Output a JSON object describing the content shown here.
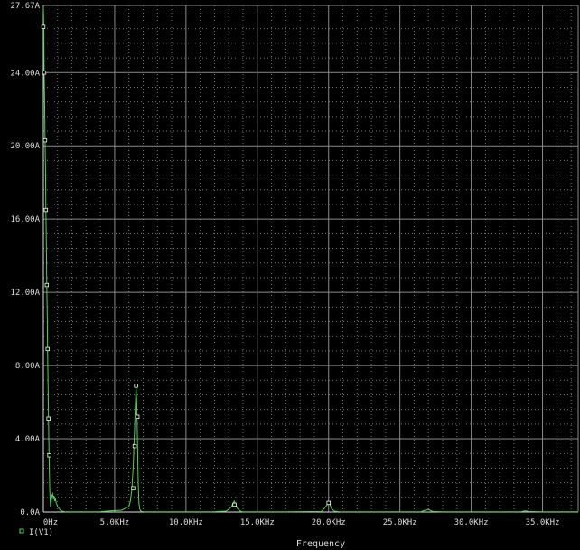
{
  "chart_data": {
    "type": "line",
    "title": "",
    "xlabel": "Frequency",
    "ylabel": "",
    "xlim": [
      0,
      37500
    ],
    "ylim": [
      0,
      27.67
    ],
    "x_tick_labels": [
      "0Hz",
      "5.0KHz",
      "10.0KHz",
      "15.0KHz",
      "20.0KHz",
      "25.0KHz",
      "30.0KHz",
      "35.0KHz"
    ],
    "x_tick_values": [
      0,
      5000,
      10000,
      15000,
      20000,
      25000,
      30000,
      35000
    ],
    "y_tick_labels": [
      "0.0A",
      "4.00A",
      "8.00A",
      "12.00A",
      "16.00A",
      "20.00A",
      "24.00A",
      "27.67A"
    ],
    "y_tick_values": [
      0,
      4,
      8,
      12,
      16,
      20,
      24,
      27.67
    ],
    "grid": true,
    "legend_position": "bottom-left",
    "series": [
      {
        "name": "I(V1)",
        "color": "#4cd64c",
        "marker": "square",
        "x": [
          0,
          30,
          60,
          90,
          120,
          150,
          180,
          210,
          240,
          270,
          300,
          330,
          360,
          400,
          450,
          500,
          550,
          600,
          650,
          700,
          750,
          800,
          850,
          900,
          1000,
          1100,
          1200,
          1300,
          1500,
          2000,
          2500,
          3000,
          3500,
          4000,
          4500,
          5000,
          5500,
          6000,
          6100,
          6200,
          6300,
          6400,
          6450,
          6500,
          6550,
          6600,
          6650,
          6700,
          6750,
          6800,
          6850,
          6900,
          7000,
          7200,
          7500,
          8000,
          9000,
          10000,
          11000,
          12000,
          12800,
          13000,
          13200,
          13300,
          13400,
          13500,
          13600,
          13800,
          14000,
          15000,
          17000,
          19500,
          19700,
          19900,
          20000,
          20100,
          20200,
          20400,
          20800,
          22000,
          24000,
          26500,
          26700,
          26900,
          27000,
          27100,
          27300,
          28000,
          30000,
          32000,
          33500,
          33700,
          33800,
          34000,
          35000,
          37500
        ],
        "y": [
          27.6,
          26.5,
          24,
          22.5,
          20.3,
          18.7,
          16.5,
          14.7,
          12.4,
          10.8,
          8.9,
          7.0,
          5.1,
          3.1,
          1.2,
          0.3,
          0.6,
          0.9,
          1.0,
          0.7,
          0.9,
          0.6,
          0.7,
          0.5,
          0.3,
          0.2,
          0.1,
          0.05,
          0.02,
          0.01,
          0.01,
          0.01,
          0.01,
          0.02,
          0.05,
          0.08,
          0.1,
          0.3,
          0.6,
          1.2,
          2.5,
          4.6,
          5.8,
          6.9,
          6.0,
          3.8,
          1.6,
          0.5,
          0.2,
          0.1,
          0.05,
          0.03,
          0.02,
          0.01,
          0.01,
          0.01,
          0.01,
          0.01,
          0.01,
          0.02,
          0.05,
          0.15,
          0.3,
          0.5,
          0.6,
          0.4,
          0.2,
          0.05,
          0.01,
          0.01,
          0.01,
          0.03,
          0.2,
          0.4,
          0.55,
          0.4,
          0.2,
          0.05,
          0.01,
          0.01,
          0.01,
          0.02,
          0.08,
          0.12,
          0.15,
          0.1,
          0.03,
          0.01,
          0.01,
          0.01,
          0.02,
          0.05,
          0.07,
          0.03,
          0.01,
          0.01
        ],
        "markers_x": [
          0,
          60,
          120,
          180,
          240,
          300,
          360,
          420,
          6300,
          6400,
          6500,
          6600,
          13400,
          20000
        ],
        "markers_y": [
          26.5,
          24,
          20.3,
          16.5,
          12.4,
          8.9,
          5.1,
          3.1,
          1.3,
          3.6,
          6.9,
          5.2,
          0.4,
          0.5
        ]
      }
    ]
  }
}
